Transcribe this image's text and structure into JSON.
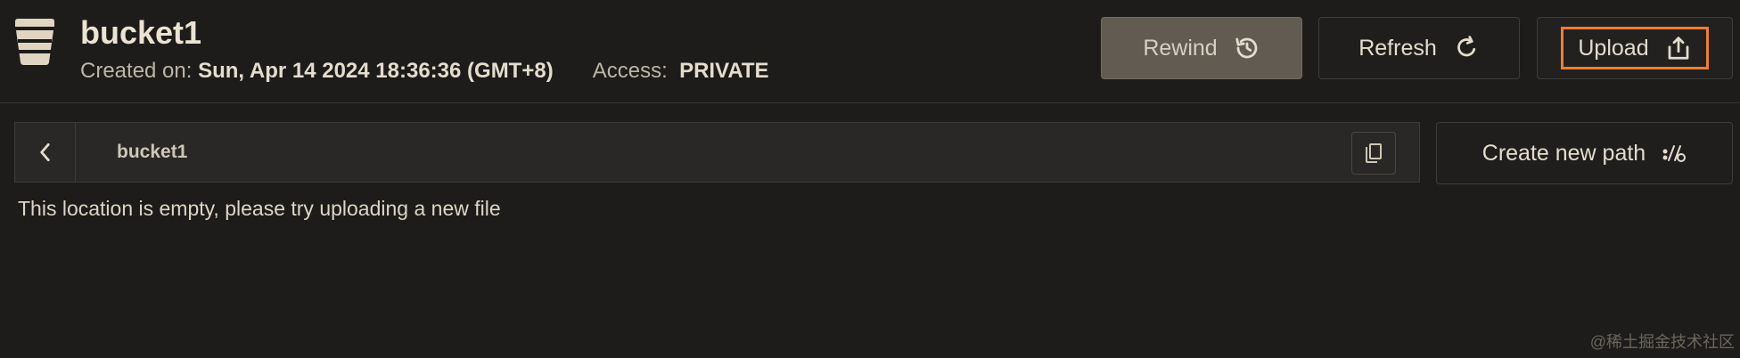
{
  "bucket": {
    "name": "bucket1",
    "created_label": "Created on:",
    "created_value": "Sun, Apr 14 2024 18:36:36 (GMT+8)",
    "access_label": "Access:",
    "access_value": "PRIVATE"
  },
  "toolbar": {
    "rewind_label": "Rewind",
    "refresh_label": "Refresh",
    "upload_label": "Upload",
    "rewind_icon": "history-icon",
    "refresh_icon": "refresh-icon",
    "upload_icon": "upload-icon"
  },
  "path": {
    "current": "bucket1",
    "create_new_path_label": "Create new path"
  },
  "content": {
    "empty_message": "This location is empty, please try uploading a new file"
  },
  "watermark": "@稀土掘金技术社区",
  "colors": {
    "background": "#1d1c1a",
    "accent_highlight": "#f07f2c",
    "rewind_bg": "#615b52"
  }
}
